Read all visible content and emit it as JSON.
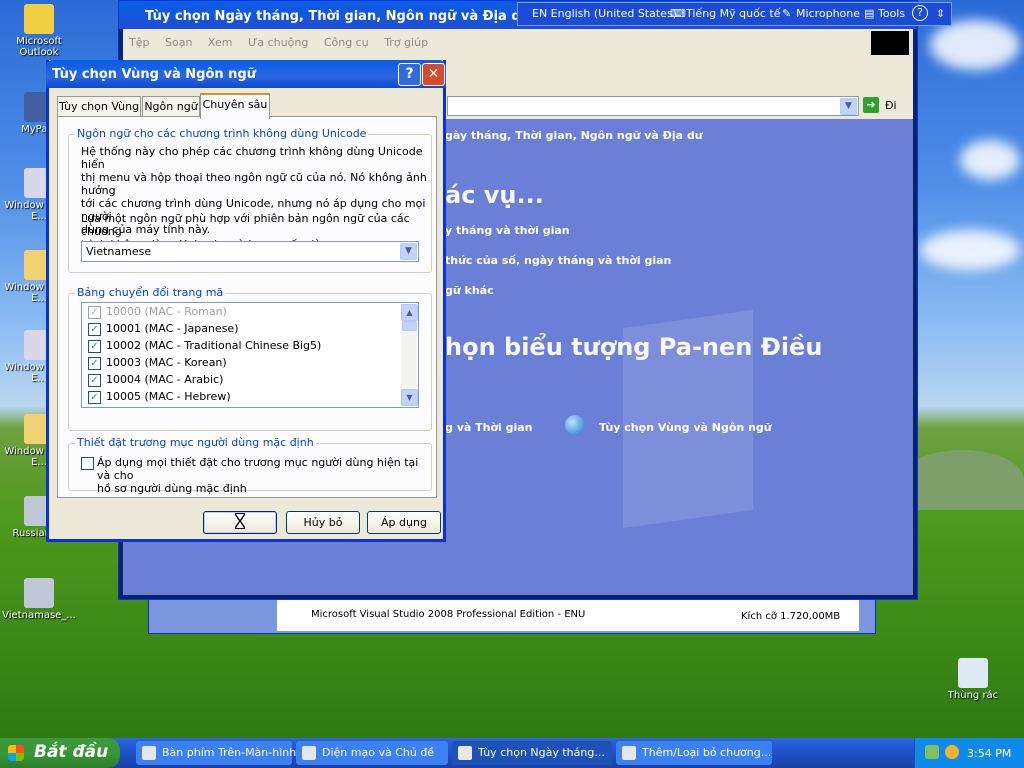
{
  "desktop": {
    "icons": [
      {
        "label": "Microsoft Outlook"
      },
      {
        "label": "MyPa..."
      },
      {
        "label": "Window Delta E..."
      },
      {
        "label": "Window Delta E..."
      },
      {
        "label": "Window Delta E..."
      },
      {
        "label": "Window Delta E..."
      },
      {
        "label": "Russian_..."
      },
      {
        "label": "Vietnamase_..."
      },
      {
        "label": "Thùng rác"
      }
    ]
  },
  "language_bar": {
    "language": "EN English (United States)",
    "keyboard": "Tiếng Mỹ quốc tế",
    "microphone": "Microphone",
    "tools": "Tools"
  },
  "control_panel": {
    "title": "Tùy chọn Ngày tháng, Thời gian, Ngôn ngữ và Địa dư",
    "menu": [
      "Tệp",
      "Soạn",
      "Xem",
      "Ưa chuộng",
      "Công cụ",
      "Trợ giúp"
    ],
    "go_label": "Đi",
    "header": "gày tháng, Thời gian, Ngôn ngữ và Địa dư",
    "task_heading": "ác vụ...",
    "tasks": [
      "y tháng và thời gian",
      "thức của số, ngày tháng và thời gian",
      "gữ khác"
    ],
    "icon_heading": "họn biểu tượng Pa-nen Điều",
    "icons": [
      "g và Thời gian",
      "Tùy chọn Vùng và Ngôn ngữ"
    ]
  },
  "background_window": {
    "row_text": "Microsoft Visual Studio 2008 Professional Edition - ENU",
    "size_text": "Kích cỡ 1.720,00MB"
  },
  "dialog": {
    "title": "Tùy chọn Vùng và Ngôn ngữ",
    "help_btn": "?",
    "close_btn": "✕",
    "tabs": [
      "Tùy chọn Vùng",
      "Ngôn ngữ",
      "Chuyên sâu"
    ],
    "unicode_group": {
      "title": "Ngôn ngữ cho các chương trình không dùng Unicode",
      "desc_lines": [
        "Hệ thống này cho phép các chương trình không dùng Unicode hiển",
        "thị menu và hộp thoại theo ngôn ngữ cũ của nó. Nó không ảnh hưởng",
        "tới các chương trình dùng Unicode, nhưng nó áp dụng cho mọi người",
        "dùng của máy tính này."
      ],
      "prompt_lines": [
        "Lựa một ngôn ngữ phù hợp với phiên bản ngôn ngữ của các chương",
        "trình không dùng Unicode mà bạn muốn dùng:"
      ],
      "selected_language": "Vietnamese"
    },
    "codepage_group": {
      "title": "Bảng chuyển đổi trang mã",
      "items": [
        {
          "label": "10000 (MAC - Roman)",
          "checked": true,
          "disabled": true
        },
        {
          "label": "10001 (MAC - Japanese)",
          "checked": true,
          "disabled": false
        },
        {
          "label": "10002 (MAC - Traditional Chinese Big5)",
          "checked": true,
          "disabled": false
        },
        {
          "label": "10003 (MAC - Korean)",
          "checked": true,
          "disabled": false
        },
        {
          "label": "10004 (MAC - Arabic)",
          "checked": true,
          "disabled": false
        },
        {
          "label": "10005 (MAC - Hebrew)",
          "checked": true,
          "disabled": false
        }
      ]
    },
    "default_user_group": {
      "title": "Thiết đặt trương mục người dùng mặc định",
      "checkbox_lines": [
        "Áp dụng mọi thiết đặt cho trương mục người dùng hiện tại và cho",
        "hồ sơ người dùng mặc định"
      ],
      "checked": false
    },
    "buttons": {
      "ok": "",
      "cancel": "Hủy bỏ",
      "apply": "Áp dụng"
    }
  },
  "taskbar": {
    "start_label": "Bắt đầu",
    "tasks": [
      {
        "label": "Bàn phím Trên-Màn-hình"
      },
      {
        "label": "Diện mạo và Chủ đề"
      },
      {
        "label": "Tùy chọn Ngày tháng..."
      },
      {
        "label": "Thêm/Loại bỏ chương..."
      }
    ],
    "clock": "3:54 PM"
  }
}
